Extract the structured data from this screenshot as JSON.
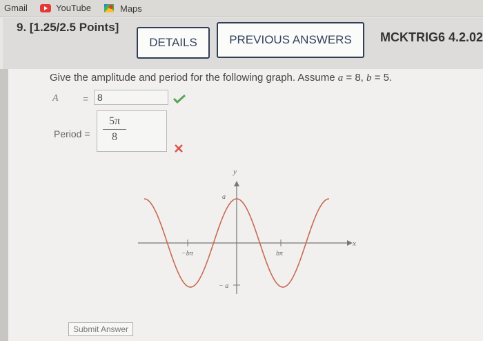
{
  "bookmarks": {
    "gmail": "Gmail",
    "youtube": "YouTube",
    "maps": "Maps"
  },
  "header": {
    "question_number": "9. [1.25/2.5 Points]",
    "details_button": "DETAILS",
    "previous_answers_button": "PREVIOUS ANSWERS",
    "course_code": "MCKTRIG6 4.2.02"
  },
  "question": {
    "prompt_text": "Give the amplitude and period for the following graph. Assume",
    "a_var": "a",
    "a_eq": " = 8, ",
    "b_var": "b",
    "b_eq": " = 5.",
    "amplitude_label": "A",
    "equals": "=",
    "amplitude_value": "8",
    "amplitude_status": "correct",
    "period_label": "Period =",
    "period_numerator": "5π",
    "period_denominator": "8",
    "period_status": "incorrect"
  },
  "graph": {
    "y_label": "y",
    "x_label": "x",
    "a_label": "a",
    "neg_a_label": "− a",
    "neg_b_pi_label": "−bπ",
    "b_pi_label": "bπ"
  },
  "colors": {
    "curve": "#c86a52",
    "check": "#5aa55a",
    "xmark": "#d9534f"
  },
  "submit_label": "Submit Answer"
}
